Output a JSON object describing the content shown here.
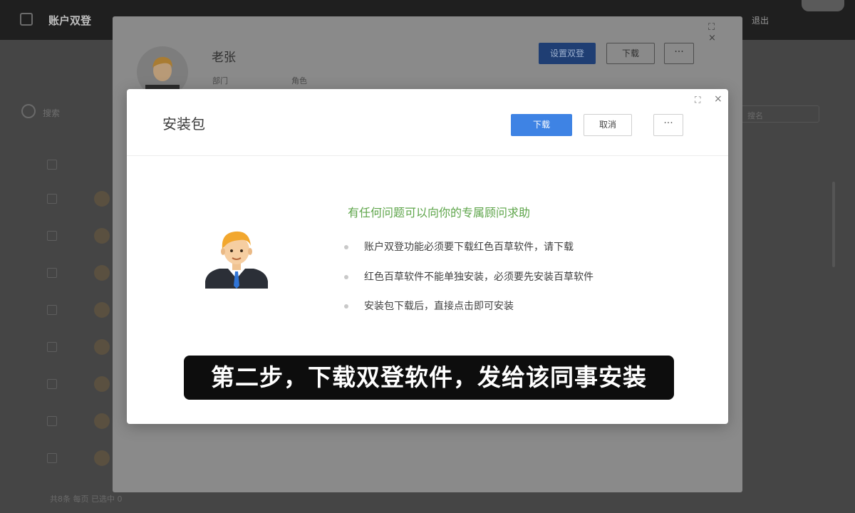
{
  "background_app": {
    "title": "账户双登",
    "topbar_right": "退出",
    "left_label": "搜索",
    "search_placeholder": "搜名",
    "footer_text": "共8条 每页 已选中 0"
  },
  "back_modal": {
    "person_name": "老张",
    "meta_dept": "部门",
    "meta_role": "角色",
    "buttons": {
      "set_dual_login": "设置双登",
      "download": "下载",
      "more": "···"
    },
    "window_icons": "⛶ ×"
  },
  "modal": {
    "title": "安装包",
    "buttons": {
      "download": "下载",
      "cancel": "取消",
      "more": "···"
    },
    "expand_icon": "⛶",
    "close_icon": "×",
    "headline": "有任何问题可以向你的专属顾问求助",
    "items": [
      "账户双登功能必须要下载红色百草软件，请下载",
      "红色百草软件不能单独安装，必须要先安装百草软件",
      "安装包下载后，直接点击即可安装"
    ]
  },
  "caption": "第二步，下载双登软件，发给该同事安装",
  "colors": {
    "primary_blue": "#3e83e4",
    "headline_green": "#5ea54a",
    "overlay_dark": "#454545"
  },
  "icons": {
    "expand": "expand-icon",
    "close": "close-icon",
    "avatar": "businessman-avatar-icon"
  }
}
